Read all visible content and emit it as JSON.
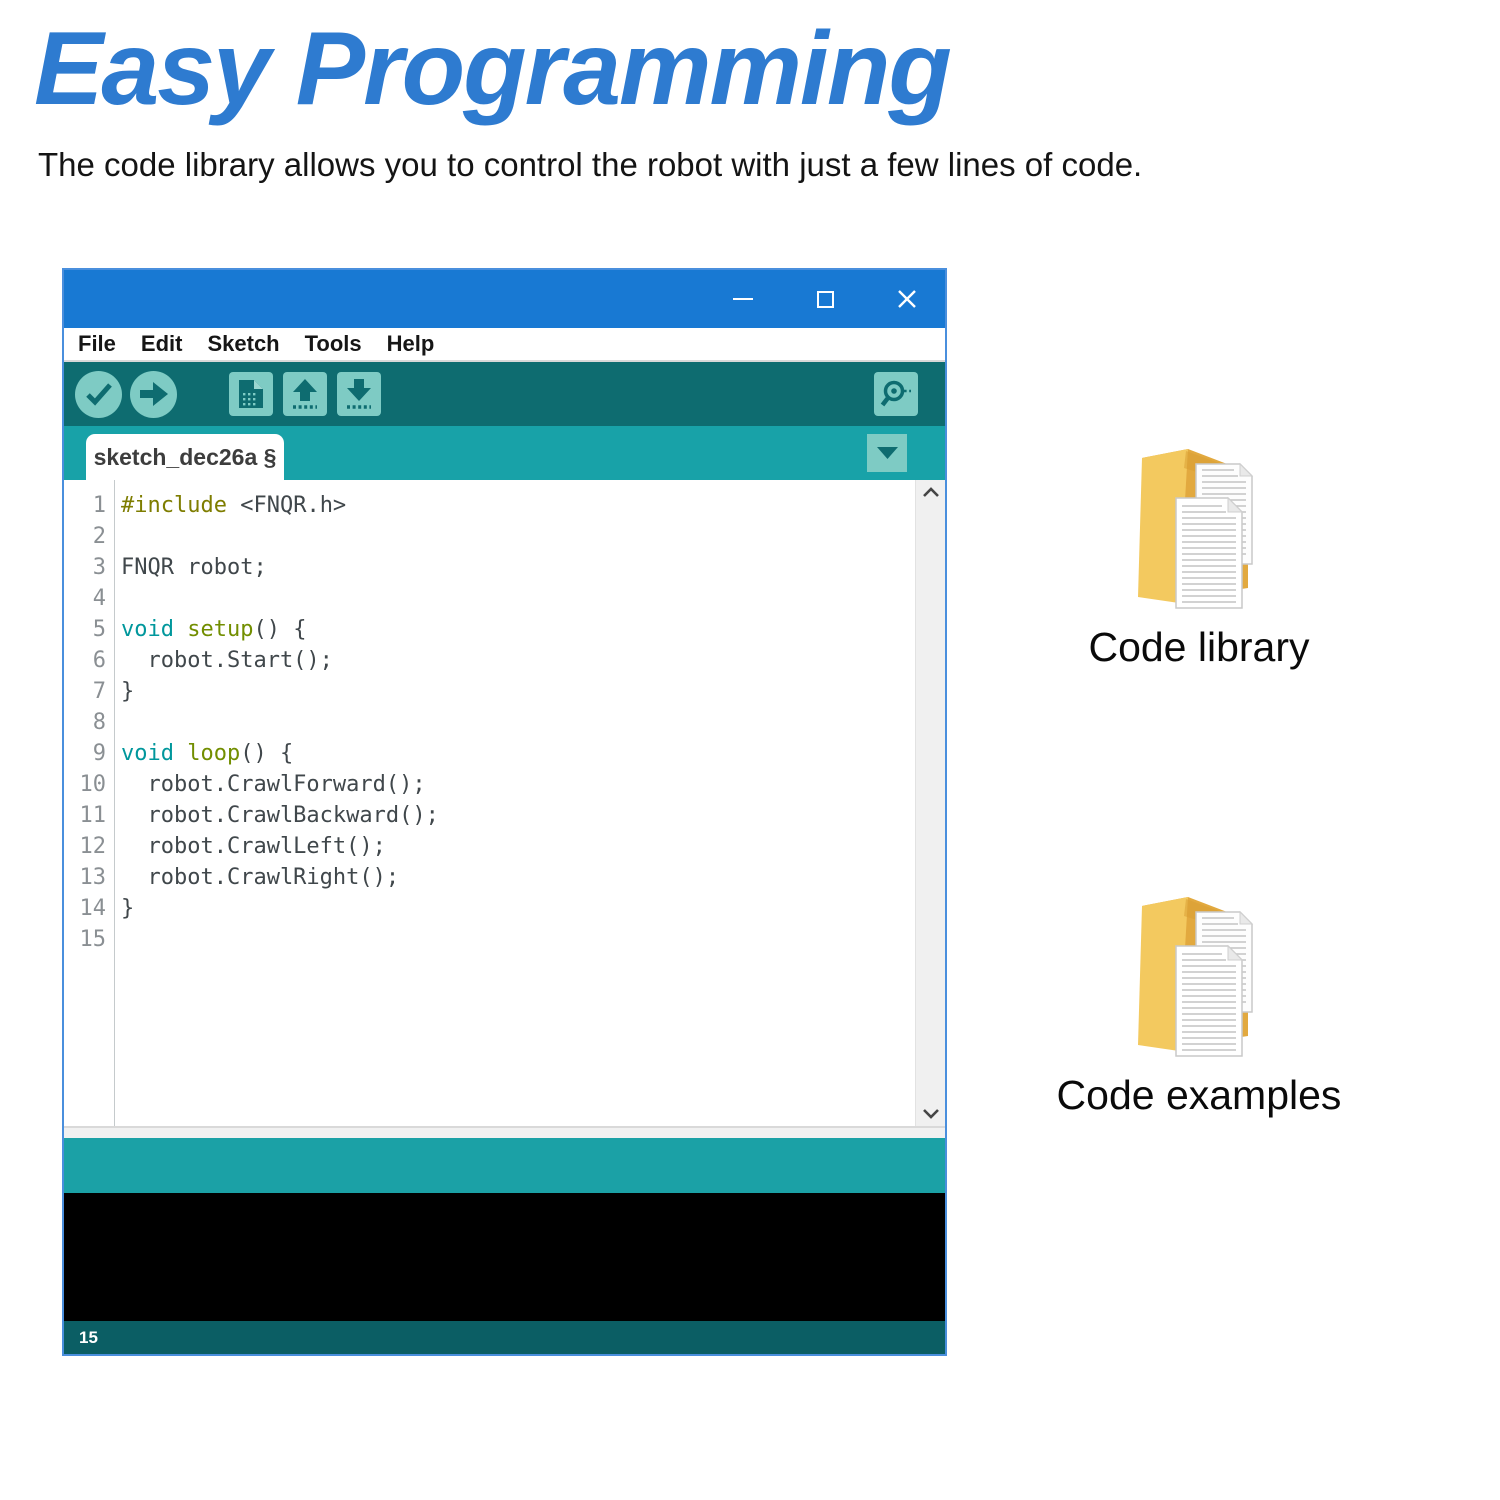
{
  "page": {
    "title": "Easy Programming",
    "subtitle": "The code library allows you to control the robot with just a few lines of code."
  },
  "colors": {
    "title_blue": "#2e7bd0",
    "titlebar_blue": "#1879d3",
    "window_border_blue": "#4a8fdd",
    "toolbar_teal": "#0e6c70",
    "tabbar_teal": "#18a2a8",
    "button_teal": "#7ecbc4",
    "statusbar_teal": "#1ba1a6",
    "footer_teal": "#0b5e64",
    "console_black": "#000000",
    "folder_yellow": "#f3c95f",
    "syntax_keyword": "#00979c",
    "syntax_function": "#728e00",
    "syntax_preprocessor": "#7e7d00",
    "syntax_plain": "#40474b"
  },
  "ide": {
    "titlebar": {
      "controls": [
        {
          "name": "minimize-icon"
        },
        {
          "name": "maximize-icon"
        },
        {
          "name": "close-icon"
        }
      ]
    },
    "menu": {
      "items": [
        "File",
        "Edit",
        "Sketch",
        "Tools",
        "Help"
      ]
    },
    "toolbar": {
      "buttons": [
        {
          "name": "verify-icon"
        },
        {
          "name": "upload-icon"
        },
        {
          "name": "new-sketch-icon"
        },
        {
          "name": "open-icon"
        },
        {
          "name": "save-icon"
        }
      ],
      "right_button": {
        "name": "serial-monitor-icon"
      }
    },
    "tabbar": {
      "tab_label": "sketch_dec26a §",
      "dropdown": {
        "name": "tab-dropdown-icon"
      }
    },
    "editor": {
      "lines": [
        {
          "num": "1",
          "segments": [
            {
              "t": "#include ",
              "c": "pre"
            },
            {
              "t": "<FNQR.h>",
              "c": "plain"
            }
          ]
        },
        {
          "num": "2",
          "segments": []
        },
        {
          "num": "3",
          "segments": [
            {
              "t": "FNQR robot;",
              "c": "plain"
            }
          ]
        },
        {
          "num": "4",
          "segments": []
        },
        {
          "num": "5",
          "segments": [
            {
              "t": "void ",
              "c": "kw"
            },
            {
              "t": "setup",
              "c": "fn"
            },
            {
              "t": "() {",
              "c": "plain"
            }
          ]
        },
        {
          "num": "6",
          "segments": [
            {
              "t": "  robot.Start();",
              "c": "plain"
            }
          ]
        },
        {
          "num": "7",
          "segments": [
            {
              "t": "}",
              "c": "plain"
            }
          ]
        },
        {
          "num": "8",
          "segments": []
        },
        {
          "num": "9",
          "segments": [
            {
              "t": "void ",
              "c": "kw"
            },
            {
              "t": "loop",
              "c": "fn"
            },
            {
              "t": "() {",
              "c": "plain"
            }
          ]
        },
        {
          "num": "10",
          "segments": [
            {
              "t": "  robot.CrawlForward();",
              "c": "plain"
            }
          ]
        },
        {
          "num": "11",
          "segments": [
            {
              "t": "  robot.CrawlBackward();",
              "c": "plain"
            }
          ]
        },
        {
          "num": "12",
          "segments": [
            {
              "t": "  robot.CrawlLeft();",
              "c": "plain"
            }
          ]
        },
        {
          "num": "13",
          "segments": [
            {
              "t": "  robot.CrawlRight();",
              "c": "plain"
            }
          ]
        },
        {
          "num": "14",
          "segments": [
            {
              "t": "}",
              "c": "plain"
            }
          ]
        },
        {
          "num": "15",
          "segments": []
        }
      ]
    },
    "footer": {
      "line_indicator": "15"
    }
  },
  "folders": [
    {
      "label": "Code library"
    },
    {
      "label": "Code examples"
    }
  ]
}
